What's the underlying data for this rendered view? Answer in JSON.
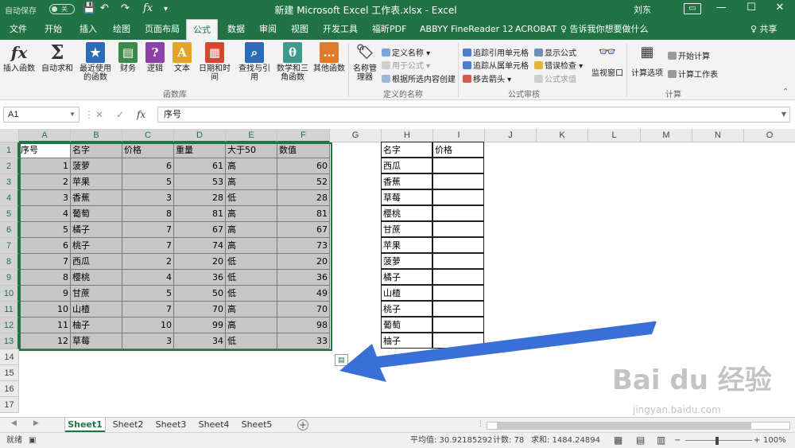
{
  "titlebar": {
    "autosave_label": "自动保存",
    "autosave_state": "关",
    "document_title": "新建 Microsoft Excel 工作表.xlsx  -  Excel",
    "user": "刘东",
    "minimize": "—",
    "restore": "☐",
    "close": "✕",
    "qat_save": "💾",
    "qat_undo": "↶",
    "qat_redo": "↷",
    "qat_fx": "fx",
    "qat_more": "▾"
  },
  "tabs": [
    "文件",
    "开始",
    "插入",
    "绘图",
    "页面布局",
    "公式",
    "数据",
    "审阅",
    "视图",
    "开发工具",
    "福昕PDF",
    "ABBYY FineReader 12",
    "ACROBAT"
  ],
  "active_tab": "公式",
  "tell_me": "♀ 告诉我你想要做什么",
  "share": "♀ 共享",
  "ribbon": {
    "insert_function": "插入函数",
    "autosum": "自动求和",
    "recent": "最近使用的函数",
    "financial": "财务",
    "logical": "逻辑",
    "text": "文本",
    "datetime": "日期和时间",
    "lookup": "查找与引用",
    "math": "数学和三角函数",
    "more": "其他函数",
    "group_library": "函数库",
    "name_manager": "名称管理器",
    "define_name": "定义名称 ▾",
    "use_in_formula": "用于公式 ▾",
    "create_from_selection": "根据所选内容创建",
    "group_names": "定义的名称",
    "trace_precedents": "追踪引用单元格",
    "trace_dependents": "追踪从属单元格",
    "remove_arrows": "移去箭头 ▾",
    "show_formulas": "显示公式",
    "error_checking": "错误检查 ▾",
    "evaluate_formula": "公式求值",
    "group_auditing": "公式审核",
    "watch_window": "监视窗口",
    "calc_options": "计算选项",
    "calc_now": "开始计算",
    "calc_sheet": "计算工作表",
    "group_calc": "计算"
  },
  "formula_bar": {
    "name_box": "A1",
    "cancel": "✕",
    "enter": "✓",
    "fx": "fx",
    "value": "序号"
  },
  "columns": [
    "A",
    "B",
    "C",
    "D",
    "E",
    "F",
    "G",
    "H",
    "I",
    "J",
    "K",
    "L",
    "M",
    "N",
    "O"
  ],
  "rows": [
    "1",
    "2",
    "3",
    "4",
    "5",
    "6",
    "7",
    "8",
    "9",
    "10",
    "11",
    "12",
    "13",
    "14",
    "15",
    "16",
    "17"
  ],
  "table_left": {
    "headers": [
      "序号",
      "名字",
      "价格",
      "重量",
      "大于50",
      "数值"
    ],
    "rows": [
      [
        "1",
        "菠萝",
        "6",
        "61",
        "高",
        "60"
      ],
      [
        "2",
        "苹果",
        "5",
        "53",
        "高",
        "52"
      ],
      [
        "3",
        "香蕉",
        "3",
        "28",
        "低",
        "28"
      ],
      [
        "4",
        "葡萄",
        "8",
        "81",
        "高",
        "81"
      ],
      [
        "5",
        "橘子",
        "7",
        "67",
        "高",
        "67"
      ],
      [
        "6",
        "桃子",
        "7",
        "74",
        "高",
        "73"
      ],
      [
        "7",
        "西瓜",
        "2",
        "20",
        "低",
        "20"
      ],
      [
        "8",
        "樱桃",
        "4",
        "36",
        "低",
        "36"
      ],
      [
        "9",
        "甘蔗",
        "5",
        "50",
        "低",
        "49"
      ],
      [
        "10",
        "山楂",
        "7",
        "70",
        "高",
        "70"
      ],
      [
        "11",
        "柚子",
        "10",
        "99",
        "高",
        "98"
      ],
      [
        "12",
        "草莓",
        "3",
        "34",
        "低",
        "33"
      ]
    ]
  },
  "table_right": {
    "headers": [
      "名字",
      "价格"
    ],
    "names": [
      "西瓜",
      "香蕉",
      "草莓",
      "樱桃",
      "甘蔗",
      "苹果",
      "菠萝",
      "橘子",
      "山楂",
      "桃子",
      "葡萄",
      "柚子"
    ]
  },
  "sheets": [
    "Sheet1",
    "Sheet2",
    "Sheet3",
    "Sheet4",
    "Sheet5"
  ],
  "active_sheet": "Sheet1",
  "add_sheet": "+",
  "status": {
    "mode": "就绪",
    "average": "平均值: 30.92185292",
    "count": "计数: 78",
    "sum": "求和: 1484.24894",
    "zoom": "100%",
    "zoom_minus": "−",
    "zoom_plus": "+"
  },
  "watermark": {
    "brand": "Bai du 经验",
    "url": "jingyan.baidu.com"
  },
  "colors": {
    "excel_green": "#217346",
    "arrow": "#3a6fd8",
    "selection_fill": "#c6c6c6"
  }
}
